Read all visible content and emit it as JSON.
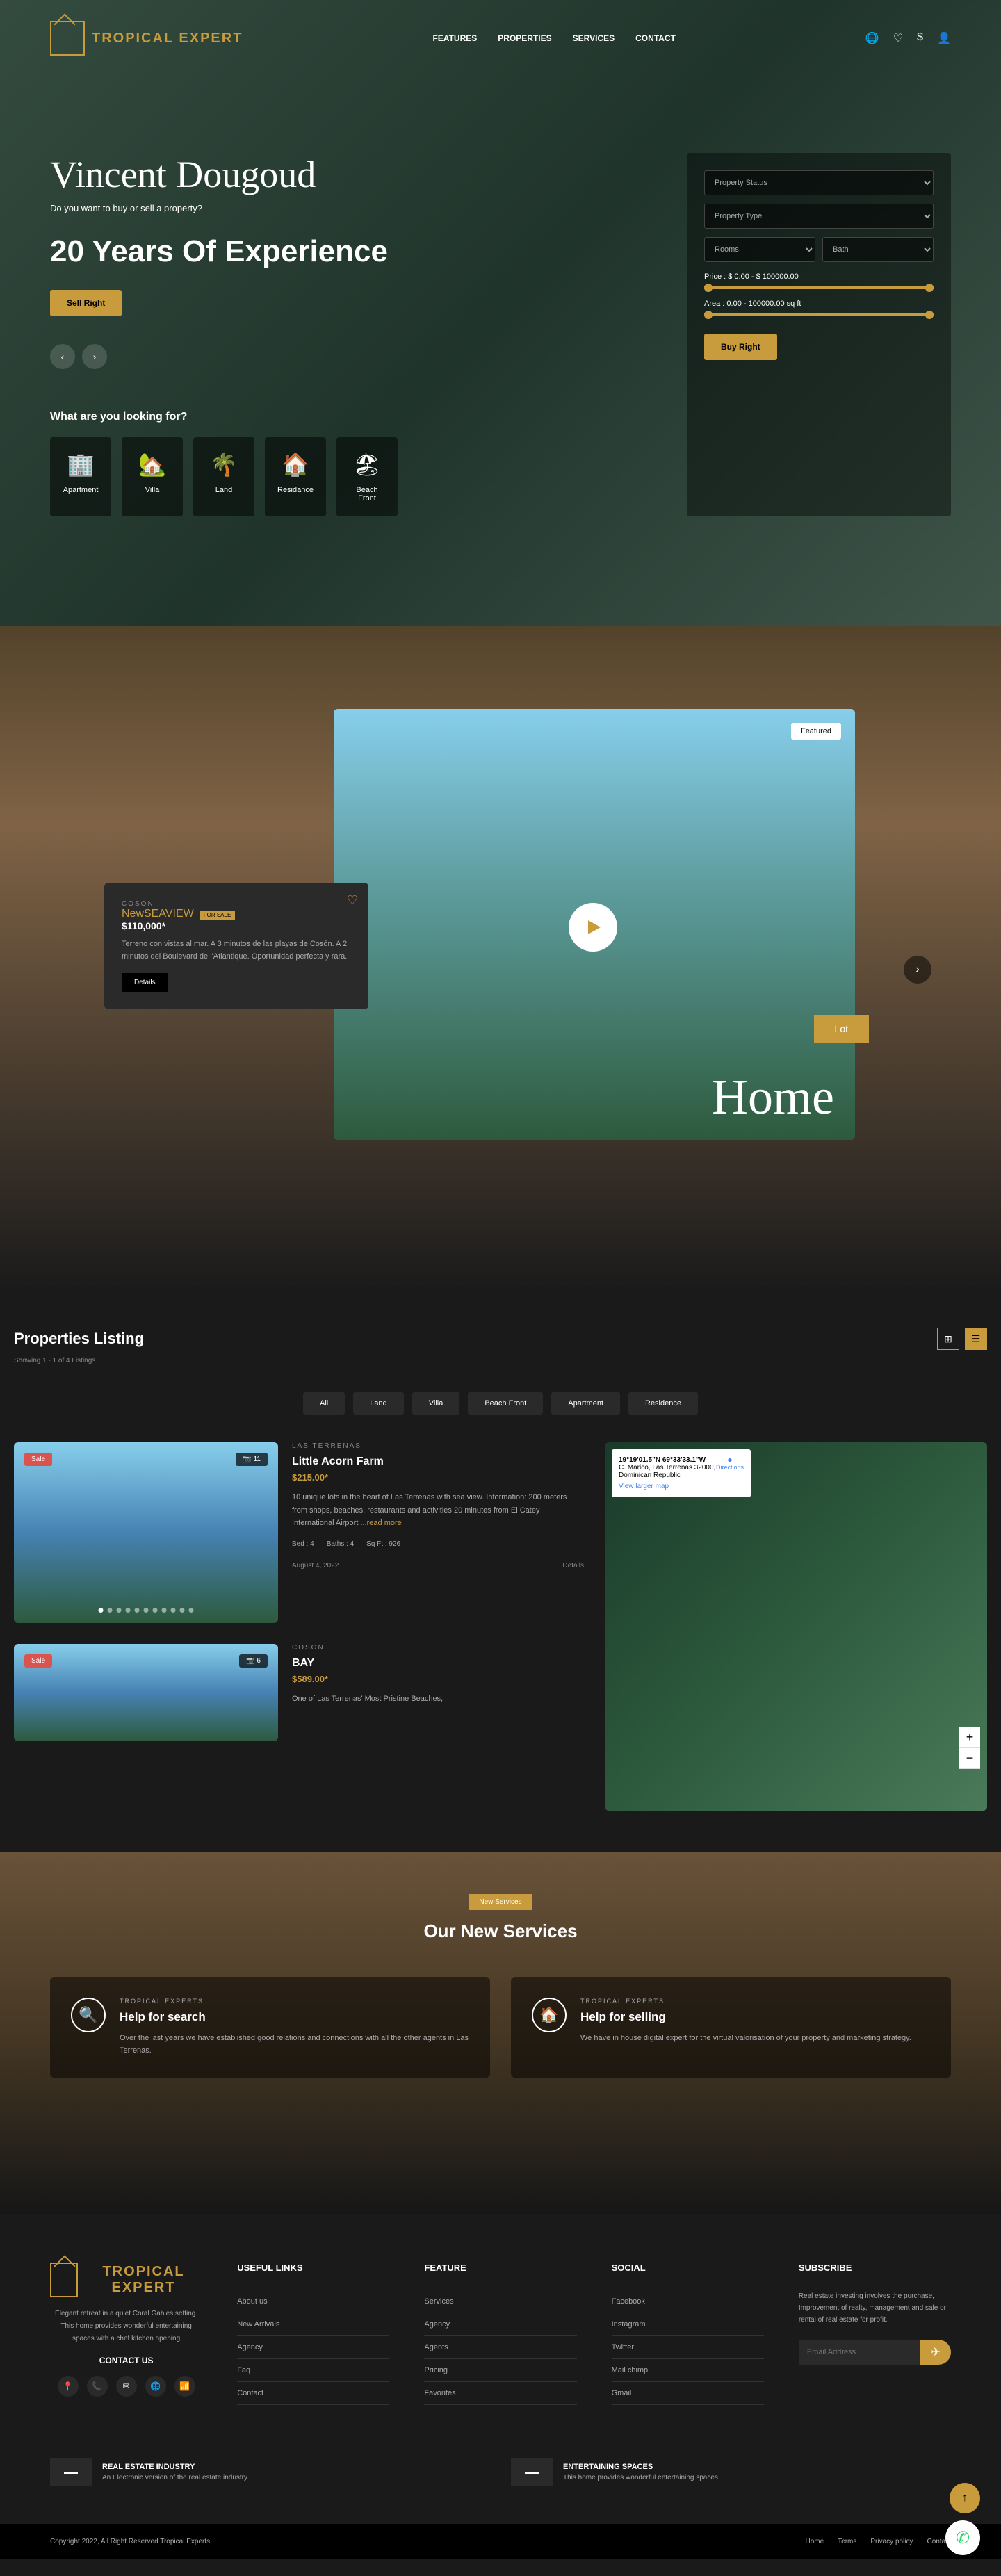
{
  "brand": "TROPICAL EXPERT",
  "nav": {
    "features": "FEATURES",
    "properties": "PROPERTIES",
    "services": "SERVICES",
    "contact": "CONTACT"
  },
  "hero": {
    "name": "Vincent Dougoud",
    "subtitle": "Do you want to buy or sell a property?",
    "headline": "20 Years Of Experience",
    "cta": "Sell Right",
    "looking": "What are you looking for?",
    "cats": [
      "Apartment",
      "Villa",
      "Land",
      "Residance",
      "Beach Front"
    ]
  },
  "search": {
    "status": "Property Status",
    "type": "Property Type",
    "rooms": "Rooms",
    "bath": "Bath",
    "price": "Price : $ 0.00 - $ 100000.00",
    "area": "Area : 0.00 - 100000.00 sq ft",
    "btn": "Buy Right"
  },
  "featured": {
    "loc": "COSON",
    "title": "NewSEAVIEW",
    "badge": "FOR SALE",
    "price": "$110,000*",
    "desc": "Terreno con vistas al mar. A 3 minutos de las playas de Cosón. A 2 minutos del Boulevard de l'Atlantique. Oportunidad perfecta y rara.",
    "details": "Details",
    "tag": "Featured",
    "lot": "Lot",
    "home": "Home"
  },
  "listings": {
    "title": "Properties Listing",
    "sub": "Showing 1 - 1 of 4 Listings",
    "filters": [
      "All",
      "Land",
      "Villa",
      "Beach Front",
      "Apartment",
      "Residence"
    ],
    "props": [
      {
        "loc": "LAS TERRENAS",
        "name": "Little Acorn Farm",
        "price": "$215.00*",
        "desc": "10 unique lots in the heart of Las Terrenas with sea view. Information: 200 meters from shops, beaches, restaurants and activities 20 minutes from El Catey International Airport ",
        "bed": "Bed : 4",
        "bath": "Baths : 4",
        "sqft": "Sq Ft : 926",
        "date": "August 4, 2022",
        "count": "📷 11",
        "sale": "Sale"
      },
      {
        "loc": "COSON",
        "name": "BAY",
        "price": "$589.00*",
        "desc": "One of Las Terrenas' Most Pristine Beaches,",
        "count": "📷 6",
        "sale": "Sale"
      }
    ],
    "map": {
      "coords": "19°19'01.5\"N 69°33'33.1\"W",
      "addr": "C. Marico, Las Terrenas 32000, Dominican Republic",
      "dir": "Directions",
      "larger": "View larger map"
    },
    "readmore": "...read more",
    "details": "Details"
  },
  "services": {
    "badge": "New Services",
    "title": "Our New Services",
    "tag": "TROPICAL EXPERTS",
    "cards": [
      {
        "name": "Help for search",
        "desc": "Over the last years we have established good relations and connections with all the other agents in Las Terrenas."
      },
      {
        "name": "Help for selling",
        "desc": "We have in house digital expert for the virtual valorisation of your property and marketing strategy."
      }
    ]
  },
  "footer": {
    "about": "Elegant retreat in a quiet Coral Gables setting. This home provides wonderful entertaining spaces with a chef kitchen opening",
    "contact": "CONTACT US",
    "cols": {
      "useful": {
        "h": "USEFUL LINKS",
        "items": [
          "About us",
          "New Arrivals",
          "Agency",
          "Faq",
          "Contact"
        ]
      },
      "feature": {
        "h": "FEATURE",
        "items": [
          "Services",
          "Agency",
          "Agents",
          "Pricing",
          "Favorites"
        ]
      },
      "social": {
        "h": "SOCIAL",
        "items": [
          "Facebook",
          "Instagram",
          "Twitter",
          "Mail chimp",
          "Gmail"
        ]
      }
    },
    "sub": {
      "h": "SUBSCRIBE",
      "desc": "Real estate investing involves the purchase, Improvement of realty, management and sale or rental of real estate for profit.",
      "ph": "Email Address"
    },
    "cards": [
      {
        "t": "REAL ESTATE INDUSTRY",
        "d": "An Electronic version of the real estate industry."
      },
      {
        "t": "ENTERTAINING SPACES",
        "d": "This home provides wonderful entertaining spaces."
      }
    ]
  },
  "copy": {
    "text": "Copyright 2022, All Right Reserved Tropical Experts",
    "links": [
      "Home",
      "Terms",
      "Privacy policy",
      "Contact"
    ]
  }
}
